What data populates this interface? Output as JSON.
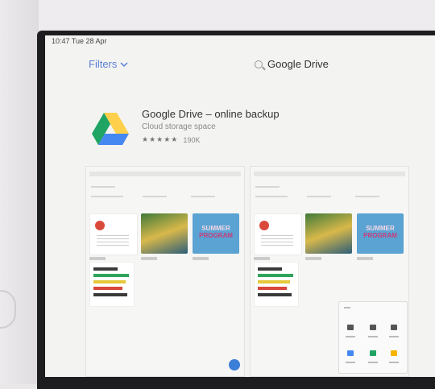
{
  "status_bar": {
    "text": "10:47  Tue 28 Apr"
  },
  "header": {
    "filters_label": "Filters",
    "search_query": "Google Drive"
  },
  "app": {
    "title": "Google Drive – online backup",
    "subtitle": "Cloud storage space",
    "stars": "★★★★★",
    "reviews": "190K"
  },
  "screenshots": {
    "poster_line1": "SUMMER",
    "poster_line2": "PROGRAM"
  },
  "colors": {
    "accent": "#5b7fd6",
    "drive_green": "#1fa463",
    "drive_yellow": "#ffd04b",
    "drive_blue": "#4688f1"
  }
}
